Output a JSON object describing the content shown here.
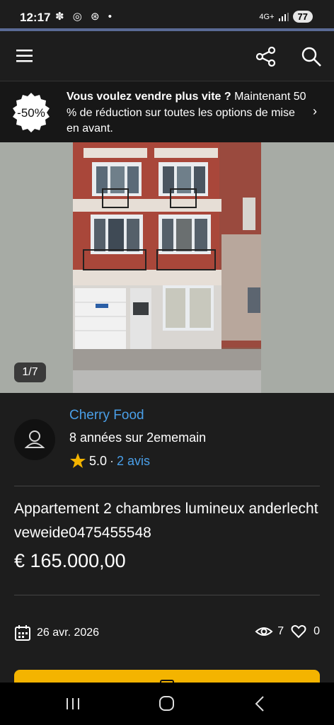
{
  "status_bar": {
    "time": "12:17",
    "network": "4G+",
    "battery": "77"
  },
  "app_bar": {
    "menu_icon": "hamburger-icon",
    "share_icon": "share-icon",
    "search_icon": "search-icon"
  },
  "promo": {
    "badge": "-50%",
    "text_bold": "Vous voulez vendre plus vite ?",
    "text_rest": " Maintenant 50 % de réduction sur toutes les options de mise en avant.",
    "chevron": "›"
  },
  "gallery": {
    "counter": "1/7"
  },
  "seller": {
    "name": "Cherry Food",
    "since": "8 années sur 2ememain",
    "rating": "5.0",
    "separator": "·",
    "reviews": "2 avis"
  },
  "listing": {
    "title": "Appartement 2 chambres lumineux anderlecht veweide0475455548",
    "price": "€ 165.000,00",
    "date": "26 avr. 2026",
    "views": "7",
    "likes": "0"
  },
  "colors": {
    "link": "#4a9fe8",
    "cta": "#f4b400",
    "background": "#1d1d1d"
  }
}
